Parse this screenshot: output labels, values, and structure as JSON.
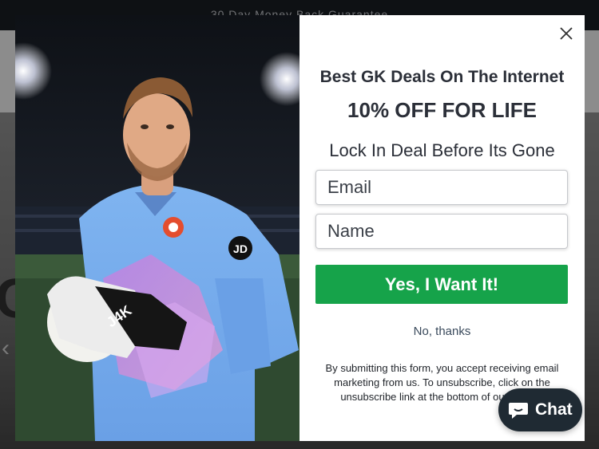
{
  "announcement": {
    "text": "30 Day Money Back Guarantee"
  },
  "popup": {
    "headline": "Best GK Deals On The Internet",
    "offer": "10% OFF FOR LIFE",
    "subheadline": "Lock In Deal Before Its Gone",
    "email_placeholder": "Email",
    "name_placeholder": "Name",
    "cta_label": "Yes, I Want It!",
    "decline_label": "No, thanks",
    "disclaimer": "By submitting this form, you accept receiving email marketing from us. To unsubscribe, click on the unsubscribe link at the bottom of our emails.",
    "cta_color": "#16a34a"
  },
  "photo": {
    "glove_text": "J4K",
    "badge_text": "JD"
  },
  "chat": {
    "label": "Chat"
  }
}
